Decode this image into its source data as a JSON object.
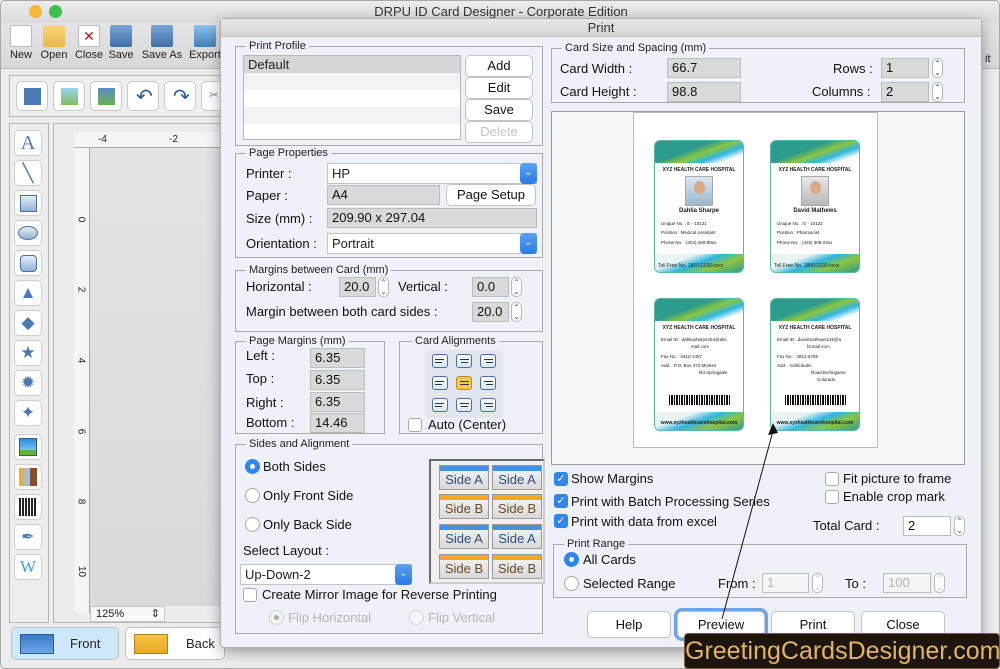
{
  "app": {
    "title": "DRPU ID Card Designer - Corporate Edition",
    "toolbar": [
      {
        "label": "New",
        "icon": "new-document-icon"
      },
      {
        "label": "Open",
        "icon": "open-folder-icon"
      },
      {
        "label": "Close",
        "icon": "close-document-icon"
      },
      {
        "label": "Save",
        "icon": "save-icon"
      },
      {
        "label": "Save As",
        "icon": "save-as-icon"
      },
      {
        "label": "Export",
        "icon": "export-icon"
      }
    ],
    "right_toolbar_partial_label": "it",
    "ruler": {
      "h_ticks": [
        "-4",
        "-2"
      ],
      "v_ticks": [
        "0",
        "2",
        "4",
        "6",
        "8",
        "10"
      ]
    },
    "zoom": "125%",
    "bottom_tabs": [
      {
        "label": "Front"
      },
      {
        "label": "Back"
      }
    ]
  },
  "dialog": {
    "title": "Print",
    "print_profile": {
      "title": "Print Profile",
      "items": [
        "Default"
      ],
      "buttons": {
        "add": "Add",
        "edit": "Edit",
        "save": "Save",
        "delete": "Delete"
      }
    },
    "page_properties": {
      "title": "Page Properties",
      "printer_label": "Printer :",
      "printer": "HP",
      "paper_label": "Paper :",
      "paper": "A4",
      "page_setup": "Page Setup",
      "size_label": "Size (mm) :",
      "size": "209.90 x 297.04",
      "orientation_label": "Orientation :",
      "orientation": "Portrait"
    },
    "margins_between_card": {
      "title": "Margins between Card (mm)",
      "horizontal_label": "Horizontal :",
      "horizontal": "20.0",
      "vertical_label": "Vertical :",
      "vertical": "0.0",
      "both_sides_label": "Margin between both card sides :",
      "both_sides": "20.0"
    },
    "page_margins": {
      "title": "Page Margins (mm)",
      "left_label": "Left :",
      "left": "6.35",
      "top_label": "Top :",
      "top": "6.35",
      "right_label": "Right :",
      "right": "6.35",
      "bottom_label": "Bottom :",
      "bottom": "14.46"
    },
    "card_alignments": {
      "title": "Card Alignments",
      "selected": "middle-center",
      "auto_label": "Auto (Center)",
      "auto": false
    },
    "sides": {
      "title": "Sides and Alignment",
      "options": [
        "Both Sides",
        "Only Front Side",
        "Only Back Side"
      ],
      "selected": "Both Sides",
      "layout_label": "Select Layout :",
      "layout": "Up-Down-2",
      "layout_preview": [
        "Side A",
        "Side A",
        "Side B",
        "Side B",
        "Side A",
        "Side A",
        "Side B",
        "Side B"
      ],
      "mirror_label": "Create Mirror Image for Reverse Printing",
      "flip_horizontal": "Flip Horizontal",
      "flip_vertical": "Flip Vertical"
    },
    "card_size": {
      "title": "Card Size and Spacing (mm)",
      "width_label": "Card Width :",
      "width": "66.7",
      "height_label": "Card Height :",
      "height": "98.8",
      "rows_label": "Rows :",
      "rows": "1",
      "columns_label": "Columns :",
      "columns": "2"
    },
    "preview_cards": [
      {
        "hospital": "XYZ HEALTH CARE HOSPITAL",
        "name": "Dahlia Sharpe",
        "unique": "Unique No.   :  E - 10121",
        "position": "Position      :  Medical Assistant",
        "phone": "Phone No.    :  (304) 430-98xx",
        "tollfree": "Toll Free No.   1800-2100-xxxx"
      },
      {
        "hospital": "XYZ HEALTH CARE HOSPITAL",
        "name": "David Mathews",
        "unique": "Unique No.   :  E - 10122",
        "position": "Position      :  Pharmacist",
        "phone": "Phone No.    :  (425) 388-23xx",
        "tollfree": "Toll Free No.   1800-2100-xxxx"
      },
      {
        "hospital": "XYZ HEALTH CARE HOSPITAL",
        "email": "Email ID :  dahliasharpe254@abc",
        "email2": "mail.com",
        "fax": "Fax No.  :  5410-1457",
        "add": "Add.       :  P.O. Box 372 Montes",
        "add2": "Rd.Springdale",
        "add3": "",
        "web": "www.xyzhealthcarehospital.com"
      },
      {
        "hospital": "XYZ HEALTH CARE HOSPITAL",
        "email": "Email ID :  davidmathews145@a",
        "email2": "bcmail.com",
        "fax": "Fax No.  :  4921-6785",
        "add": "Add.       :        Sollicitudin",
        "add2": "Road,Burlingame",
        "add3": "Colorado",
        "web": "www.xyzhealthcarehospital.com"
      }
    ],
    "options": {
      "show_margins": "Show Margins",
      "show_margins_checked": true,
      "batch": "Print with Batch Processing Series",
      "batch_checked": true,
      "excel": "Print with data from excel",
      "excel_checked": true,
      "fit": "Fit picture to frame",
      "fit_checked": false,
      "crop": "Enable crop mark",
      "crop_checked": false,
      "total_label": "Total Card :",
      "total": "2"
    },
    "print_range": {
      "title": "Print Range",
      "all": "All Cards",
      "selected_range": "Selected Range",
      "selected": "All Cards",
      "from_label": "From :",
      "from": "1",
      "to_label": "To :",
      "to": "100"
    },
    "buttons": {
      "help": "Help",
      "preview": "Preview",
      "print": "Print",
      "close": "Close"
    }
  },
  "watermark": "GreetingCardsDesigner.com"
}
